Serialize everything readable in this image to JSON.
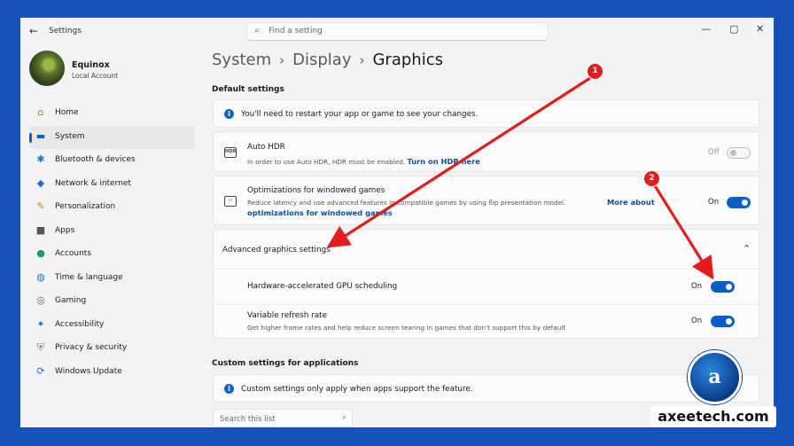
{
  "window": {
    "title": "Settings",
    "search_placeholder": "Find a setting",
    "back_icon": "back-arrow-icon"
  },
  "profile": {
    "name": "Equinox",
    "account": "Local Account"
  },
  "nav": [
    {
      "label": "Home",
      "icon": "⌂",
      "color": "#c46a3a"
    },
    {
      "label": "System",
      "icon": "▬",
      "color": "#0a64c8",
      "active": true
    },
    {
      "label": "Bluetooth & devices",
      "icon": "✱",
      "color": "#1a74d2"
    },
    {
      "label": "Network & internet",
      "icon": "◆",
      "color": "#1a74d2"
    },
    {
      "label": "Personalization",
      "icon": "✎",
      "color": "#c97a2a"
    },
    {
      "label": "Apps",
      "icon": "■",
      "color": "#555"
    },
    {
      "label": "Accounts",
      "icon": "●",
      "color": "#1f9a5a"
    },
    {
      "label": "Time & language",
      "icon": "◍",
      "color": "#1a74d2"
    },
    {
      "label": "Gaming",
      "icon": "◎",
      "color": "#666"
    },
    {
      "label": "Accessibility",
      "icon": "✦",
      "color": "#1a74d2"
    },
    {
      "label": "Privacy & security",
      "icon": "⛨",
      "color": "#777"
    },
    {
      "label": "Windows Update",
      "icon": "⟳",
      "color": "#1a74d2"
    }
  ],
  "breadcrumb": {
    "a": "System",
    "b": "Display",
    "c": "Graphics",
    "sep": "›"
  },
  "default_settings": {
    "heading": "Default settings",
    "restart_notice": "You'll need to restart your app or game to see your changes.",
    "auto_hdr": {
      "title": "Auto HDR",
      "desc": "In order to use Auto HDR, HDR must be enabled.",
      "link": "Turn on HDR here",
      "state": "Off"
    },
    "windowed": {
      "title": "Optimizations for windowed games",
      "desc": "Reduce latency and use advanced features in compatible games by using flip presentation model.",
      "link1": "More about",
      "link2": "optimizations for windowed games",
      "state": "On"
    }
  },
  "advanced": {
    "title": "Advanced graphics settings",
    "gpu": {
      "label": "Hardware-accelerated GPU scheduling",
      "state": "On"
    },
    "vrr": {
      "label": "Variable refresh rate",
      "desc": "Get higher frame rates and help reduce screen tearing in games that don't support this by default",
      "state": "On"
    }
  },
  "custom": {
    "heading": "Custom settings for applications",
    "notice": "Custom settings only apply when apps support the feature.",
    "search_placeholder": "Search this list"
  },
  "annotations": {
    "one": "1",
    "two": "2",
    "color": "#e11d1d"
  },
  "watermark": {
    "text": "axeetech.com"
  }
}
